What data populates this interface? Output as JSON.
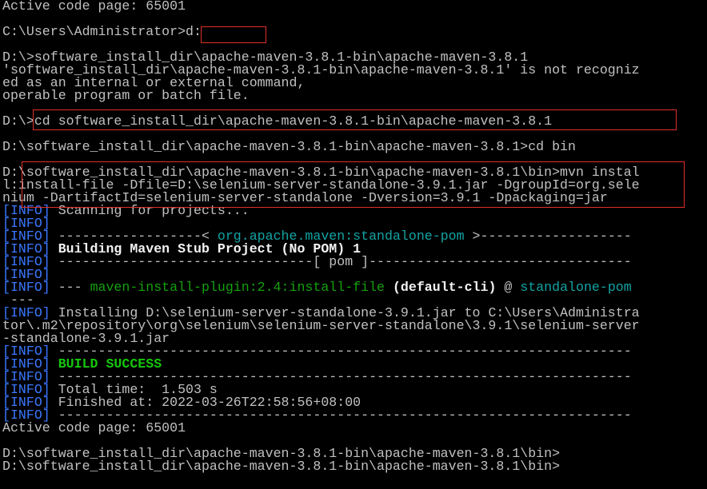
{
  "terminal": {
    "lines": [
      {
        "parts": [
          {
            "t": "Active code page: 65001"
          }
        ]
      },
      {
        "parts": [
          {
            "t": ""
          }
        ]
      },
      {
        "parts": [
          {
            "t": "C:\\Users\\Administrator>d:"
          }
        ]
      },
      {
        "parts": [
          {
            "t": ""
          }
        ]
      },
      {
        "parts": [
          {
            "t": "D:\\>software_install_dir\\apache-maven-3.8.1-bin\\apache-maven-3.8.1"
          }
        ]
      },
      {
        "parts": [
          {
            "t": "'software_install_dir\\apache-maven-3.8.1-bin\\apache-maven-3.8.1' is not recogniz"
          }
        ]
      },
      {
        "parts": [
          {
            "t": "ed as an internal or external command,"
          }
        ]
      },
      {
        "parts": [
          {
            "t": "operable program or batch file."
          }
        ]
      },
      {
        "parts": [
          {
            "t": ""
          }
        ]
      },
      {
        "parts": [
          {
            "t": "D:\\>cd software_install_dir\\apache-maven-3.8.1-bin\\apache-maven-3.8.1"
          }
        ]
      },
      {
        "parts": [
          {
            "t": ""
          }
        ]
      },
      {
        "parts": [
          {
            "t": "D:\\software_install_dir\\apache-maven-3.8.1-bin\\apache-maven-3.8.1>cd bin"
          }
        ]
      },
      {
        "parts": [
          {
            "t": ""
          }
        ]
      },
      {
        "parts": [
          {
            "t": "D:\\software_install_dir\\apache-maven-3.8.1-bin\\apache-maven-3.8.1\\bin>mvn instal"
          }
        ]
      },
      {
        "parts": [
          {
            "t": "l:install-file -Dfile=D:\\selenium-server-standalone-3.9.1.jar -DgroupId=org.sele"
          }
        ]
      },
      {
        "parts": [
          {
            "t": "nium -DartifactId=selenium-server-standalone -Dversion=3.9.1 -Dpackaging=jar"
          }
        ]
      },
      {
        "parts": [
          {
            "t": "[",
            "c": "info"
          },
          {
            "t": "INFO",
            "c": "info"
          },
          {
            "t": "] ",
            "c": "info"
          },
          {
            "t": "Scanning for projects..."
          }
        ]
      },
      {
        "parts": [
          {
            "t": "[INFO]",
            "c": "info"
          }
        ]
      },
      {
        "parts": [
          {
            "t": "[INFO] ",
            "c": "info"
          },
          {
            "t": "------------------< "
          },
          {
            "t": "org.apache.maven:standalone-pom",
            "c": "cyan"
          },
          {
            "t": " >-------------------"
          }
        ]
      },
      {
        "parts": [
          {
            "t": "[INFO] ",
            "c": "info"
          },
          {
            "t": "Building Maven Stub Project (No POM) 1",
            "c": "bold"
          }
        ]
      },
      {
        "parts": [
          {
            "t": "[INFO] ",
            "c": "info"
          },
          {
            "t": "--------------------------------[ pom ]---------------------------------"
          }
        ]
      },
      {
        "parts": [
          {
            "t": "[INFO]",
            "c": "info"
          }
        ]
      },
      {
        "parts": [
          {
            "t": "[INFO] ",
            "c": "info"
          },
          {
            "t": "--- "
          },
          {
            "t": "maven-install-plugin:2.4:install-file",
            "c": "green"
          },
          {
            "t": " (default-cli)",
            "c": "bold"
          },
          {
            "t": " @ "
          },
          {
            "t": "standalone-pom",
            "c": "cyan"
          }
        ]
      },
      {
        "parts": [
          {
            "t": " ---"
          }
        ]
      },
      {
        "parts": [
          {
            "t": "[INFO] ",
            "c": "info"
          },
          {
            "t": "Installing D:\\selenium-server-standalone-3.9.1.jar to C:\\Users\\Administra"
          }
        ]
      },
      {
        "parts": [
          {
            "t": "tor\\.m2\\repository\\org\\selenium\\selenium-server-standalone\\3.9.1\\selenium-server"
          }
        ]
      },
      {
        "parts": [
          {
            "t": "-standalone-3.9.1.jar"
          }
        ]
      },
      {
        "parts": [
          {
            "t": "[INFO] ",
            "c": "info"
          },
          {
            "t": "------------------------------------------------------------------------"
          }
        ]
      },
      {
        "parts": [
          {
            "t": "[INFO] ",
            "c": "info"
          },
          {
            "t": "BUILD SUCCESS",
            "c": "bgreen"
          }
        ]
      },
      {
        "parts": [
          {
            "t": "[INFO] ",
            "c": "info"
          },
          {
            "t": "------------------------------------------------------------------------"
          }
        ]
      },
      {
        "parts": [
          {
            "t": "[INFO] ",
            "c": "info"
          },
          {
            "t": "Total time:  1.503 s"
          }
        ]
      },
      {
        "parts": [
          {
            "t": "[INFO] ",
            "c": "info"
          },
          {
            "t": "Finished at: 2022-03-26T22:58:56+08:00"
          }
        ]
      },
      {
        "parts": [
          {
            "t": "[INFO] ",
            "c": "info"
          },
          {
            "t": "------------------------------------------------------------------------"
          }
        ]
      },
      {
        "parts": [
          {
            "t": "Active code page: 65001"
          }
        ]
      },
      {
        "parts": [
          {
            "t": ""
          }
        ]
      },
      {
        "parts": [
          {
            "t": "D:\\software_install_dir\\apache-maven-3.8.1-bin\\apache-maven-3.8.1\\bin>"
          }
        ]
      },
      {
        "parts": [
          {
            "t": "D:\\software_install_dir\\apache-maven-3.8.1-bin\\apache-maven-3.8.1\\bin>"
          }
        ]
      }
    ]
  },
  "colors": {
    "background": "#000000",
    "text": "#c0c0c0",
    "info": "#3b78ff",
    "highlight_box": "#e0302a"
  }
}
